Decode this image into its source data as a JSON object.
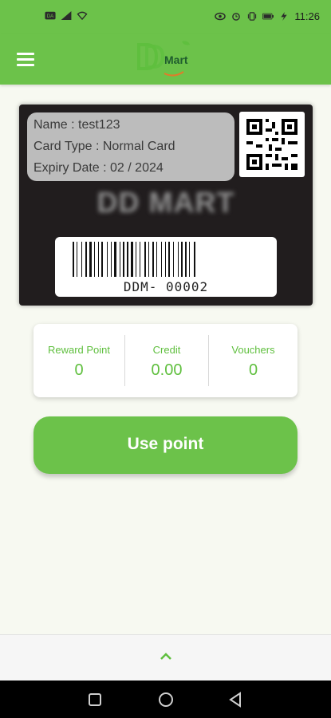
{
  "status_bar": {
    "time": "11:26",
    "left_icons": [
      "notification-icon",
      "signal-icon",
      "wifi-icon"
    ],
    "right_icons": [
      "eye-icon",
      "alarm-icon",
      "vibrate-icon",
      "battery-icon",
      "bolt-icon"
    ]
  },
  "app_bar": {
    "logo_text": "Mart",
    "menu_icon": "hamburger-icon"
  },
  "card": {
    "name": "Name : test123",
    "card_type": "Card Type : Normal Card",
    "expiry": "Expiry Date : 02 / 2024",
    "brand": "DD MART",
    "barcode_number": "DDM- 00002"
  },
  "stats": [
    {
      "label": "Reward Point",
      "value": "0"
    },
    {
      "label": "Credit",
      "value": "0.00"
    },
    {
      "label": "Vouchers",
      "value": "0"
    }
  ],
  "actions": {
    "use_point_label": "Use point"
  },
  "bottom_sheet": {
    "toggle_icon": "chevron-up-icon"
  },
  "nav": {
    "buttons": [
      "recents-icon",
      "home-icon",
      "back-icon"
    ]
  },
  "colors": {
    "primary": "#6cc24a",
    "card_bg": "#211d1e",
    "stat_text": "#5fbf3e"
  }
}
